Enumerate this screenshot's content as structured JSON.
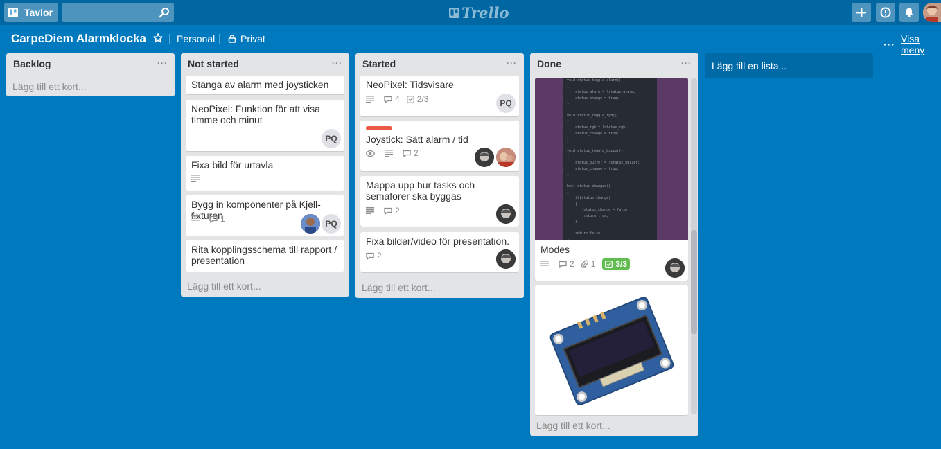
{
  "header": {
    "boards_label": "Tavlor",
    "search_placeholder": "",
    "logo_text": "Trello"
  },
  "board": {
    "title": "CarpeDiem Alarmklocka",
    "team": "Personal",
    "visibility": "Privat",
    "menu_label": "Visa meny"
  },
  "add_card_label": "Lägg till ett kort...",
  "add_list_label": "Lägg till en lista...",
  "lists": [
    {
      "title": "Backlog",
      "cards": []
    },
    {
      "title": "Not started",
      "cards": [
        {
          "title": "Stänga av alarm med joysticken"
        },
        {
          "title": "NeoPixel: Funktion för att visa timme och minut",
          "members": [
            "PQ"
          ]
        },
        {
          "title": "Fixa bild för urtavla",
          "description": true
        },
        {
          "title": "Bygg in komponenter på Kjell-fixturen",
          "description": true,
          "comments": "1",
          "members": [
            "photo",
            "PQ"
          ]
        },
        {
          "title": "Rita kopplingsschema till rapport / presentation"
        }
      ]
    },
    {
      "title": "Started",
      "cards": [
        {
          "title": "NeoPixel: Tidsvisare",
          "description": true,
          "comments": "4",
          "checklist": "2/3",
          "members": [
            "PQ"
          ]
        },
        {
          "title": "Joystick: Sätt alarm / tid",
          "label": "red",
          "watching": true,
          "description": true,
          "comments": "2",
          "members": [
            "photo",
            "photo"
          ]
        },
        {
          "title": "Mappa upp hur tasks och semaforer ska byggas",
          "description": true,
          "comments": "2",
          "members": [
            "photo"
          ]
        },
        {
          "title": "Fixa bilder/video för presentation.",
          "comments": "2",
          "members": [
            "photo"
          ]
        }
      ]
    },
    {
      "title": "Done",
      "cards": [
        {
          "title": "Modes",
          "cover": "code",
          "description": true,
          "comments": "2",
          "attachments": "1",
          "checklist": "3/3",
          "members": [
            "photo"
          ]
        },
        {
          "title": "",
          "cover": "oled-display"
        }
      ]
    }
  ],
  "members": {
    "pq": "PQ"
  },
  "colors": {
    "background": "#0079bf",
    "header": "#0067a3",
    "label_red": "#eb5a46",
    "checklist_done": "#61bd4f"
  },
  "code_lines": [
    "void status_toggle_alarm()",
    "{",
    "    status_alarm = !status_alarm;",
    "    status_change = true;",
    "}",
    "",
    "void status_toggle_rgb()",
    "{",
    "    status_rgb = !status_rgb;",
    "    status_change = true;",
    "}",
    "",
    "void status_toggle_buzzer()",
    "{",
    "    status_buzzer = !status_buzzer;",
    "    status_change = true;",
    "}",
    "",
    "bool status_changed()",
    "{",
    "    if(status_change)",
    "    {",
    "        status_change = false;",
    "        return true;",
    "    }",
    "",
    "    return false;",
    "}"
  ]
}
